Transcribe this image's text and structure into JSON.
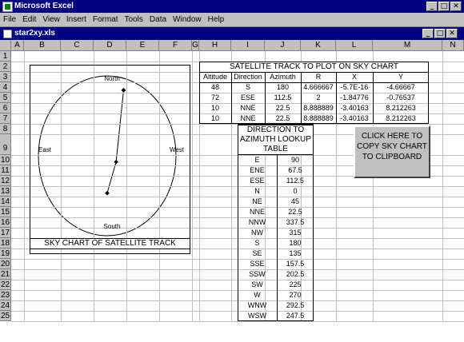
{
  "app": {
    "title": "Microsoft Excel"
  },
  "window_buttons": {
    "minimize": "_",
    "restore": "□",
    "close": "✕"
  },
  "menu": [
    "File",
    "Edit",
    "View",
    "Insert",
    "Format",
    "Tools",
    "Data",
    "Window",
    "Help"
  ],
  "workbook": {
    "title": "star2xy.xls"
  },
  "columns": [
    "A",
    "B",
    "C",
    "D",
    "E",
    "F",
    "G",
    "H",
    "I",
    "J",
    "K",
    "L",
    "M",
    "N"
  ],
  "rows": [
    "1",
    "2",
    "3",
    "4",
    "5",
    "6",
    "7",
    "8",
    "9",
    "10",
    "11",
    "12",
    "13",
    "14",
    "15",
    "16",
    "17",
    "18",
    "19",
    "20",
    "21",
    "22",
    "23",
    "24",
    "25"
  ],
  "sky_chart": {
    "north": "North",
    "south": "South",
    "east": "East",
    "west": "West",
    "caption": "SKY CHART OF SATELLITE TRACK"
  },
  "track_table": {
    "title": "SATELLITE TRACK TO PLOT ON SKY CHART",
    "headers": [
      "Altitude",
      "Direction",
      "Azimuth",
      "R",
      "X",
      "Y"
    ],
    "rows": [
      [
        "48",
        "S",
        "180",
        "4.666667",
        "-5.7E-16",
        "-4.66667"
      ],
      [
        "72",
        "ESE",
        "112.5",
        "2",
        "-1.84776",
        "-0.76537"
      ],
      [
        "10",
        "NNE",
        "22.5",
        "8.888889",
        "-3.40163",
        "8.212263"
      ],
      [
        "10",
        "NNE",
        "22.5",
        "8.888889",
        "-3.40163",
        "8.212263"
      ]
    ]
  },
  "lookup_table": {
    "title_lines": [
      "DIRECTION TO",
      "AZIMUTH LOOKUP",
      "TABLE"
    ],
    "rows": [
      [
        "E",
        "90"
      ],
      [
        "ENE",
        "67.5"
      ],
      [
        "ESE",
        "112.5"
      ],
      [
        "N",
        "0"
      ],
      [
        "NE",
        "45"
      ],
      [
        "NNE",
        "22.5"
      ],
      [
        "NNW",
        "337.5"
      ],
      [
        "NW",
        "315"
      ],
      [
        "S",
        "180"
      ],
      [
        "SE",
        "135"
      ],
      [
        "SSE",
        "157.5"
      ],
      [
        "SSW",
        "202.5"
      ],
      [
        "SW",
        "225"
      ],
      [
        "W",
        "270"
      ],
      [
        "WNW",
        "292.5"
      ],
      [
        "WSW",
        "247.5"
      ]
    ]
  },
  "copy_button": {
    "lines": [
      "CLICK HERE TO",
      "COPY SKY CHART",
      "TO CLIPBOARD"
    ]
  }
}
